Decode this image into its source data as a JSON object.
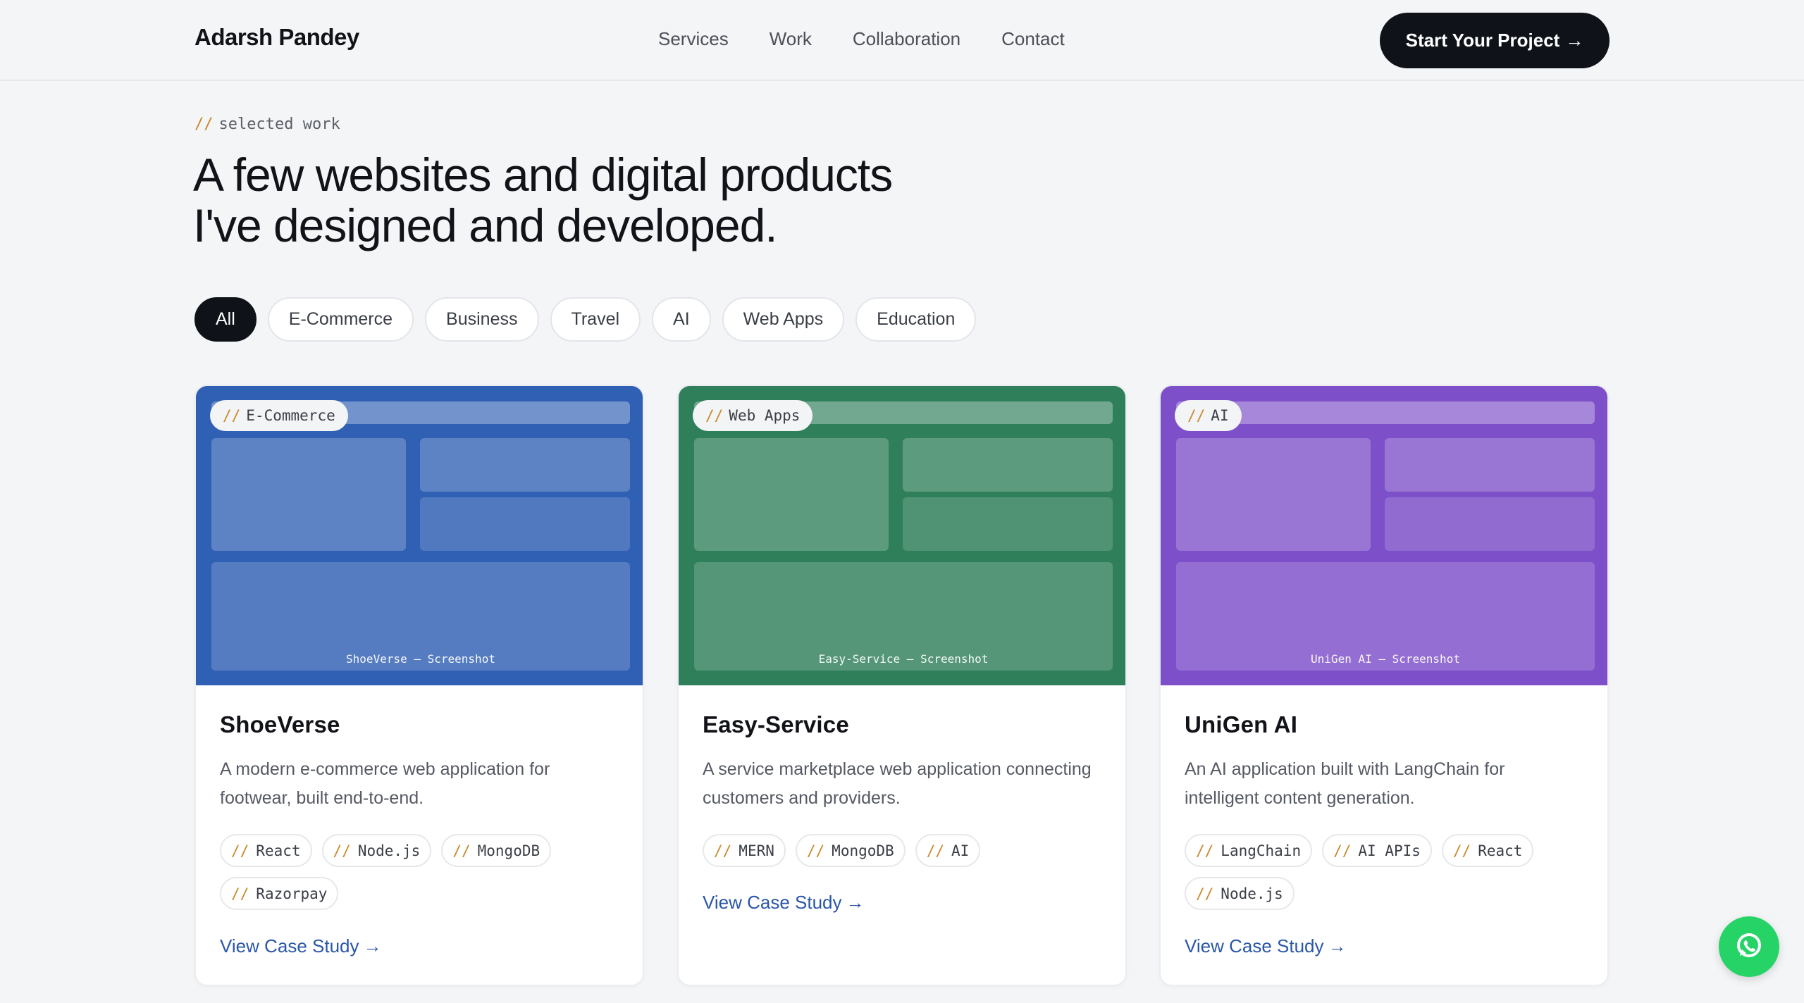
{
  "header": {
    "brand": "Adarsh Pandey",
    "nav": [
      "Services",
      "Work",
      "Collaboration",
      "Contact"
    ],
    "cta_label": "Start Your Project",
    "cta_arrow": "→"
  },
  "intro": {
    "eyebrow_prefix": "//",
    "eyebrow": "selected work",
    "headline_line1": "A few websites and digital products",
    "headline_line2": "I've designed and developed."
  },
  "filters": {
    "active": "All",
    "items": [
      "All",
      "E-Commerce",
      "Business",
      "Travel",
      "AI",
      "Web Apps",
      "Education"
    ]
  },
  "projects": [
    {
      "category": "E-Commerce",
      "caption": "ShoeVerse — Screenshot",
      "title": "ShoeVerse",
      "description": "A modern e-commerce web application for footwear, built end-to-end.",
      "tech": [
        "React",
        "Node.js",
        "MongoDB",
        "Razorpay"
      ],
      "link_label": "View Case Study",
      "color": "#3060b4"
    },
    {
      "category": "Web Apps",
      "caption": "Easy-Service — Screenshot",
      "title": "Easy-Service",
      "description": "A service marketplace web application connecting customers and providers.",
      "tech": [
        "MERN",
        "MongoDB",
        "AI"
      ],
      "link_label": "View Case Study",
      "color": "#2f7f5a"
    },
    {
      "category": "AI",
      "caption": "UniGen AI — Screenshot",
      "title": "UniGen AI",
      "description": "An AI application built with LangChain for intelligent content generation.",
      "tech": [
        "LangChain",
        "AI APIs",
        "React",
        "Node.js"
      ],
      "link_label": "View Case Study",
      "color": "#7d4fc8"
    }
  ],
  "link_arrow": "→",
  "tag_prefix": "//",
  "icons": {
    "cta": "arrow-right-icon",
    "whatsapp": "whatsapp-icon"
  },
  "colors": {
    "accent_slash": "#c9892a",
    "link": "#2a56a8",
    "dark": "#0f1218",
    "whatsapp": "#25d366"
  }
}
